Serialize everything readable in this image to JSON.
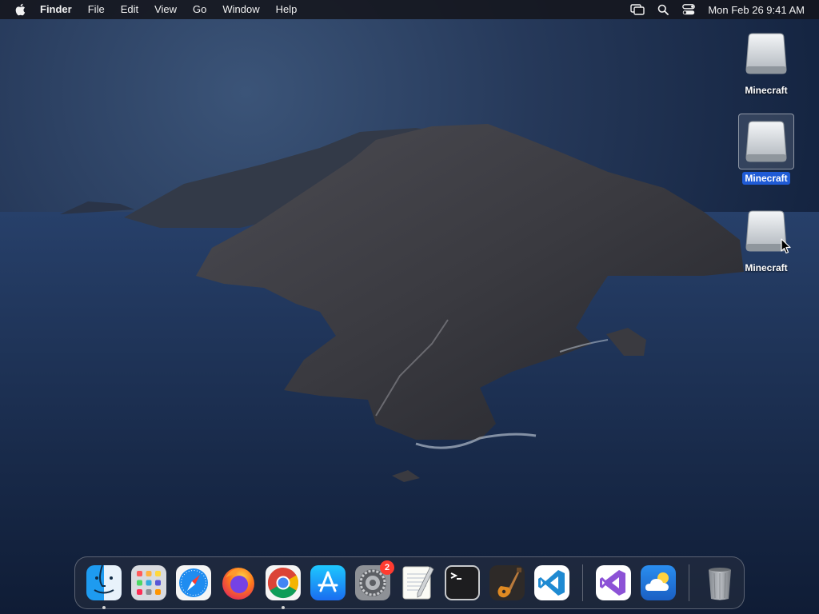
{
  "menubar": {
    "apple_icon": "apple-logo-icon",
    "app_name": "Finder",
    "menus": [
      "File",
      "Edit",
      "View",
      "Go",
      "Window",
      "Help"
    ],
    "status_icons": [
      "screen-mirroring-icon",
      "spotlight-search-icon",
      "control-center-icon"
    ],
    "clock": "Mon Feb 26  9:41 AM"
  },
  "desktop": {
    "drives": [
      {
        "label": "Minecraft",
        "icon": "external-drive-icon",
        "selected": false
      },
      {
        "label": "Minecraft",
        "icon": "external-drive-icon",
        "selected": true
      },
      {
        "label": "Minecraft",
        "icon": "external-drive-icon",
        "selected": false
      }
    ]
  },
  "dock": {
    "apps": [
      {
        "name": "Finder",
        "icon": "finder-icon",
        "running": true
      },
      {
        "name": "Launchpad",
        "icon": "launchpad-icon",
        "running": false
      },
      {
        "name": "Safari",
        "icon": "safari-icon",
        "running": false
      },
      {
        "name": "Firefox",
        "icon": "firefox-icon",
        "running": false
      },
      {
        "name": "Google Chrome",
        "icon": "chrome-icon",
        "running": true
      },
      {
        "name": "App Store",
        "icon": "app-store-icon",
        "running": false
      },
      {
        "name": "System Settings",
        "icon": "system-settings-icon",
        "running": false,
        "badge": "2"
      },
      {
        "name": "TextEdit",
        "icon": "textedit-icon",
        "running": false
      },
      {
        "name": "Terminal",
        "icon": "terminal-icon",
        "running": false
      },
      {
        "name": "GarageBand",
        "icon": "garageband-icon",
        "running": false
      },
      {
        "name": "Visual Studio Code",
        "icon": "vscode-icon",
        "running": false
      },
      {
        "name": "Visual Studio",
        "icon": "visual-studio-icon",
        "running": false
      },
      {
        "name": "Weather",
        "icon": "weather-icon",
        "running": false
      },
      {
        "name": "Trash",
        "icon": "trash-icon",
        "running": false
      }
    ]
  },
  "colors": {
    "selection": "#1f5bd6",
    "badge": "#ff3b30",
    "menubar": "#14161c"
  }
}
